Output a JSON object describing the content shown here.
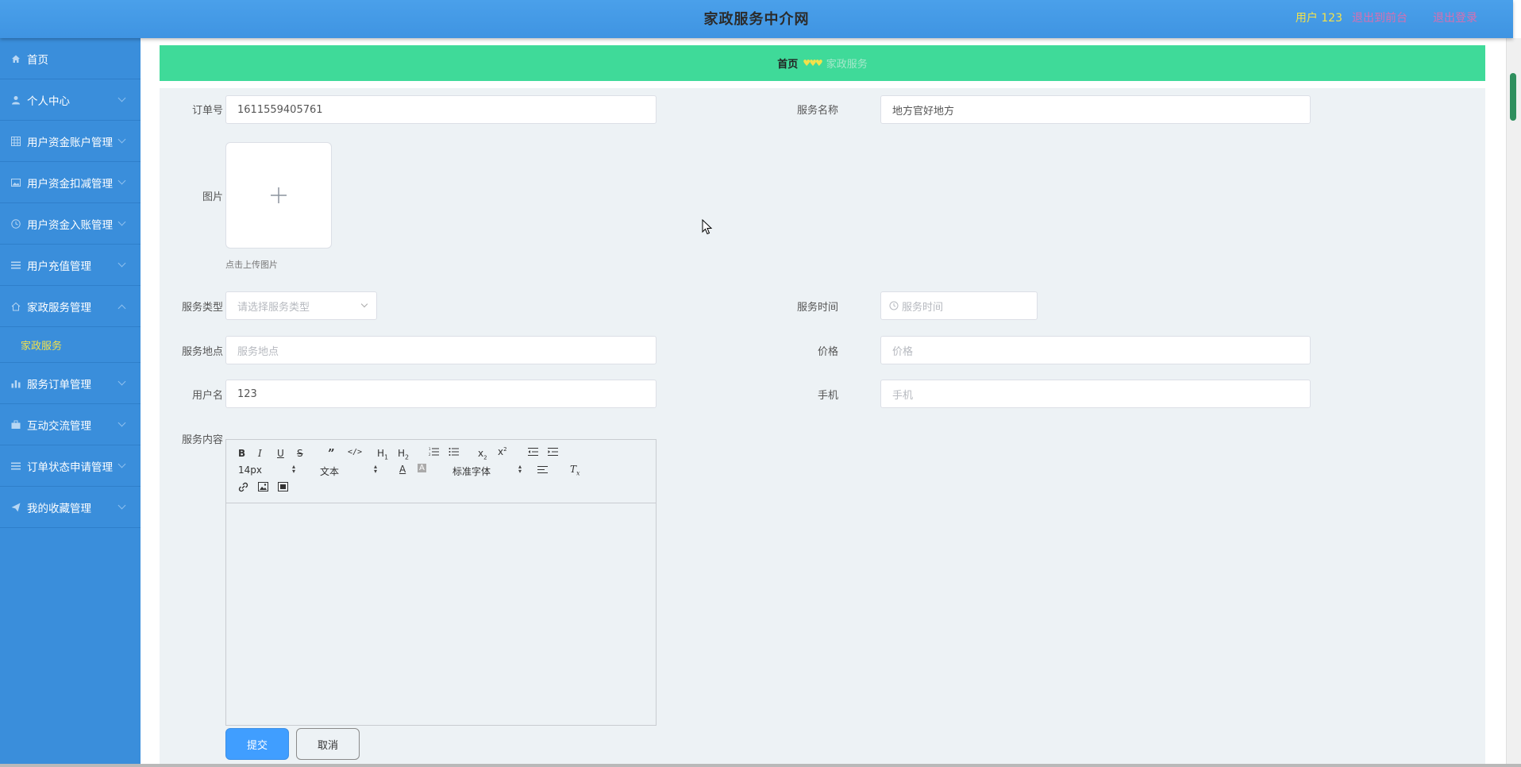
{
  "header": {
    "title": "家政服务中介网",
    "user": "用户 123",
    "to_front": "退出到前台",
    "logout": "退出登录"
  },
  "sidebar": {
    "items": [
      {
        "label": "首页",
        "icon": "home-icon"
      },
      {
        "label": "个人中心",
        "icon": "person-icon"
      },
      {
        "label": "用户资金账户管理",
        "icon": "grid-icon"
      },
      {
        "label": "用户资金扣减管理",
        "icon": "picture-icon"
      },
      {
        "label": "用户资金入账管理",
        "icon": "clock-icon"
      },
      {
        "label": "用户充值管理",
        "icon": "list-icon"
      },
      {
        "label": "家政服务管理",
        "icon": "house-icon"
      },
      {
        "label": "服务订单管理",
        "icon": "bar-chart-icon"
      },
      {
        "label": "互动交流管理",
        "icon": "briefcase-icon"
      },
      {
        "label": "订单状态申请管理",
        "icon": "list-icon"
      },
      {
        "label": "我的收藏管理",
        "icon": "paper-plane-icon"
      }
    ],
    "sub_item": "家政服务"
  },
  "breadcrumb": {
    "home": "首页",
    "current": "家政服务"
  },
  "form": {
    "order_no_label": "订单号",
    "order_no_value": "1611559405761",
    "service_name_label": "服务名称",
    "service_name_value": "地方官好地方",
    "image_label": "图片",
    "upload_hint": "点击上传图片",
    "service_type_label": "服务类型",
    "service_type_placeholder": "请选择服务类型",
    "service_time_label": "服务时间",
    "service_time_placeholder": "服务时间",
    "service_place_label": "服务地点",
    "service_place_placeholder": "服务地点",
    "price_label": "价格",
    "price_placeholder": "价格",
    "username_label": "用户名",
    "username_value": "123",
    "phone_label": "手机",
    "phone_placeholder": "手机",
    "content_label": "服务内容"
  },
  "editor": {
    "font_size": "14px",
    "text_style": "文本",
    "font_family": "标准字体"
  },
  "buttons": {
    "submit": "提交",
    "cancel": "取消"
  },
  "colors": {
    "header_bg": "#4aa0ea",
    "sidebar_bg": "#3a8edb",
    "breadcrumb_bg": "#3fda99",
    "accent_yellow": "#f3e14b",
    "link_pink": "#d86fb1",
    "submit_blue": "#409eff"
  }
}
